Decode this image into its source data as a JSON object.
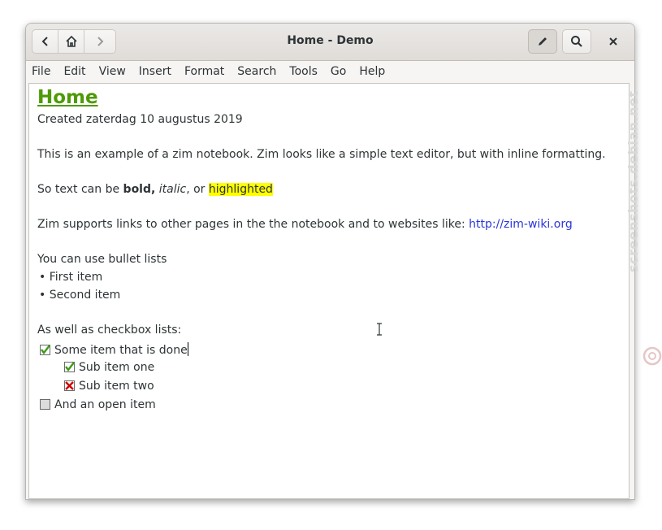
{
  "window": {
    "title": "Home - Demo"
  },
  "headerbar": {
    "back_icon": "chevron-left-icon",
    "home_icon": "home-icon",
    "forward_icon": "chevron-right-icon",
    "edit_icon": "pencil-icon",
    "search_icon": "search-icon",
    "close_icon": "close-icon"
  },
  "menubar": {
    "items": [
      "File",
      "Edit",
      "View",
      "Insert",
      "Format",
      "Search",
      "Tools",
      "Go",
      "Help"
    ]
  },
  "page": {
    "title": "Home",
    "created": "Created zaterdag 10 augustus 2019",
    "intro": "This is an example of a zim notebook. Zim looks like a simple text editor, but with inline formatting.",
    "formatting": {
      "prefix": "So text can be ",
      "bold": "bold,",
      "sep1": " ",
      "italic": "italic",
      "sep2": ", or ",
      "highlight": "highlighted"
    },
    "links": {
      "text": "Zim supports links to other pages in the the notebook and to websites like: ",
      "url": "http://zim-wiki.org"
    },
    "bullets_intro": "You can use bullet lists",
    "bullets": [
      "• First item",
      "• Second item"
    ],
    "checkbox_intro": "As well as checkbox lists:",
    "checkboxes": [
      {
        "label": "Some item that is done",
        "state": "done"
      },
      {
        "label": "Sub item one",
        "state": "done"
      },
      {
        "label": "Sub item two",
        "state": "cancelled"
      },
      {
        "label": "And an open item",
        "state": "open"
      }
    ]
  },
  "colors": {
    "title_green": "#4e9a06",
    "link_blue": "#2a36d8",
    "highlight": "#ffff00"
  },
  "watermark": "screenshots.debian.net"
}
